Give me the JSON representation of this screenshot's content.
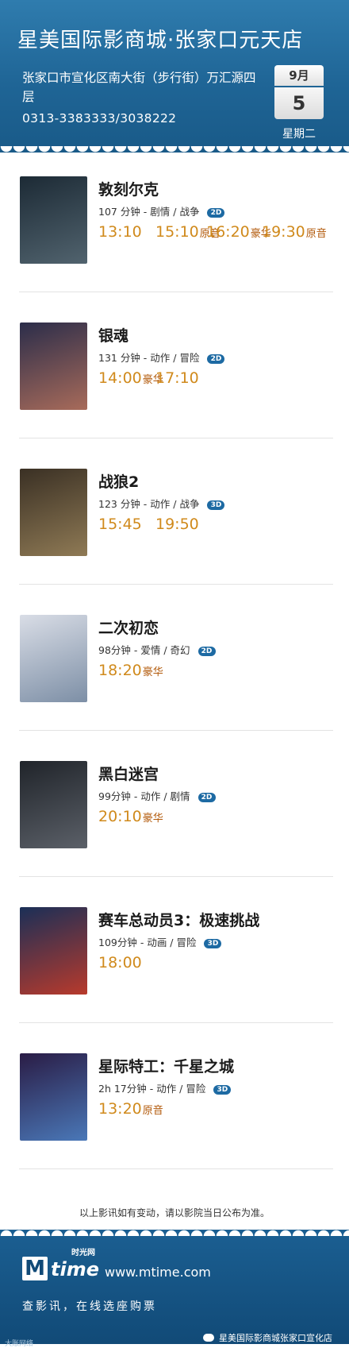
{
  "header": {
    "cinema_name": "星美国际影商城·张家口元天店",
    "address": "张家口市宣化区南大街（步行街）万汇源四层",
    "phone": "0313-3383333/3038222",
    "date": {
      "month": "9月",
      "day": "5",
      "weekday": "星期二"
    }
  },
  "movies": [
    {
      "title": "敦刻尔克",
      "info": "107 分钟 - 剧情 / 战争",
      "format": "2D",
      "showtimes": [
        {
          "time": "13:10",
          "tag": ""
        },
        {
          "time": "15:10",
          "tag": "原音"
        },
        {
          "time": "16:20",
          "tag": "豪华"
        },
        {
          "time": "19:30",
          "tag": "原音"
        }
      ]
    },
    {
      "title": "银魂",
      "info": "131 分钟 - 动作 / 冒险",
      "format": "2D",
      "showtimes": [
        {
          "time": "14:00",
          "tag": "豪华"
        },
        {
          "time": "17:10",
          "tag": ""
        }
      ]
    },
    {
      "title": "战狼2",
      "info": "123 分钟 - 动作 / 战争",
      "format": "3D",
      "showtimes": [
        {
          "time": "15:45",
          "tag": ""
        },
        {
          "time": "19:50",
          "tag": ""
        }
      ]
    },
    {
      "title": "二次初恋",
      "info": "98分钟 - 爱情 / 奇幻",
      "format": "2D",
      "showtimes": [
        {
          "time": "18:20",
          "tag": "豪华"
        }
      ]
    },
    {
      "title": "黑白迷宫",
      "info": "99分钟 - 动作 / 剧情",
      "format": "2D",
      "showtimes": [
        {
          "time": "20:10",
          "tag": "豪华"
        }
      ]
    },
    {
      "title": "赛车总动员3：极速挑战",
      "info": "109分钟 - 动画 / 冒险",
      "format": "3D",
      "showtimes": [
        {
          "time": "18:00",
          "tag": ""
        }
      ]
    },
    {
      "title": "星际特工：千星之城",
      "info": "2h 17分钟 - 动作 / 冒险",
      "format": "3D",
      "showtimes": [
        {
          "time": "13:20",
          "tag": "原音"
        }
      ]
    }
  ],
  "notice": "以上影讯如有变动，请以影院当日公布为准。",
  "footer": {
    "logo_letter": "M",
    "logo_word": "time",
    "logo_cn": "时光网",
    "url": "www.mtime.com",
    "slogan": "查影讯，在线选座购票",
    "watermark_left": "大账网络",
    "watermark_right": "星美国际影商城张家口宣化店"
  },
  "colors": {
    "header_blue": "#1f6596",
    "showtime_orange": "#d08a1c",
    "tag_brown": "#b2590a",
    "badge_blue": "#1d6aa3"
  }
}
